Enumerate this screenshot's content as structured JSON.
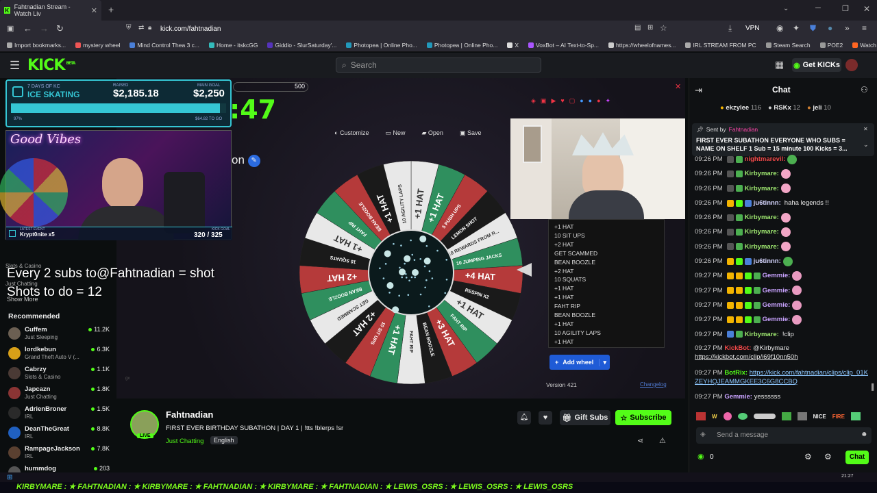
{
  "browser": {
    "tab_title": "Fahtnadian Stream - Watch Liv",
    "url": "kick.com/fahtnadian",
    "vpn_label": "VPN",
    "bookmarks": [
      "Import bookmarks...",
      "mystery wheel",
      "Mind Control Thea 3 c...",
      "Home - itskcGG",
      "Giddio - SlurSaturday'...",
      "Photopea | Online Pho...",
      "Photopea | Online Pho...",
      "X",
      "VoxBot – AI Text-to-Sp...",
      "https://wheelofnames...",
      "IRL STREAM FROM PC",
      "Steam Search",
      "POE2",
      "Watch Supernatural - ..."
    ]
  },
  "header": {
    "logo": "KICK",
    "logo_badge": "BETA",
    "search_placeholder": "Search",
    "get_kicks": "Get KICKs"
  },
  "sidebar": {
    "behind_overlay": [
      "Slots & Casino",
      "Just Chatting",
      "Show More"
    ],
    "recommended_title": "Recommended",
    "items": [
      {
        "name": "Cuffem",
        "category": "Just Sleeping",
        "viewers": "11.2K",
        "color": "#6b5f52"
      },
      {
        "name": "lordkebun",
        "category": "Grand Theft Auto V (...",
        "viewers": "6.3K",
        "color": "#d8a018"
      },
      {
        "name": "Cabrzy",
        "category": "Slots & Casino",
        "viewers": "1.1K",
        "color": "#4a3a35"
      },
      {
        "name": "Japcazn",
        "category": "Just Chatting",
        "viewers": "1.8K",
        "color": "#8a3434"
      },
      {
        "name": "AdrienBroner",
        "category": "IRL",
        "viewers": "1.5K",
        "color": "#2a2a2a"
      },
      {
        "name": "DeanTheGreat",
        "category": "IRL",
        "viewers": "8.8K",
        "color": "#2060c0"
      },
      {
        "name": "RampageJackson",
        "category": "IRL",
        "viewers": "7.8K",
        "color": "#5a4030"
      },
      {
        "name": "hummdog",
        "category": "",
        "viewers": "203",
        "color": "#555"
      }
    ]
  },
  "stream": {
    "goal": {
      "subtitle": "7 DAYS OF KC",
      "title": "ICE SKATING",
      "raised_label": "RAISED",
      "raised": "$2,185.18",
      "main_goal_label": "MAIN GOAL",
      "main_goal": "$2,250",
      "percent_text": "97%",
      "remaining": "$64.82 TO GO",
      "progress": 0.97
    },
    "latest_event_label": "LATEST EVENT",
    "latest_event": "Krypt0nite x5",
    "kick_goal_label": "KICK GOAL",
    "kick_goal": "320 / 325",
    "timer_fragment": ":47",
    "timer_max": "500",
    "toolbar": [
      "Customize",
      "New",
      "Open",
      "Save"
    ],
    "title_fragment": "on",
    "overlay_line1": "Every 2 subs to@Fahtnadian = shot",
    "overlay_line2": "Shots to do = 12",
    "wheel_center_caption": "",
    "wheel_segments": [
      "+1 HAT",
      "+1 HAT",
      "5 PUSH UPS",
      "LEMON SHOT",
      "10 REWARDS FROM R...",
      "10 JUMPING JACKS",
      "+4 HAT",
      "RESPIN X2",
      "+1 HAT",
      "FAHT RIP",
      "+3 HAT",
      "BEAN BOOZLE",
      "FAHT RIP",
      "+1 HAT",
      "10 SIT UPS",
      "+2 HAT",
      "GET SCAMMED",
      "BEAN BOOZLE",
      "+2 HAT",
      "10 SQUATS",
      "+1 HAT",
      "FAHT RIP",
      "BEAN BOOZLE",
      "+1 HAT",
      "10 AGILITY LAPS"
    ],
    "options_list": [
      "+1 HAT",
      "10 SIT UPS",
      "+2 HAT",
      "GET SCAMMED",
      "BEAN BOOZLE",
      "+2 HAT",
      "10 SQUATS",
      "+1 HAT",
      "+1 HAT",
      "FAHT RIP",
      "BEAN BOOZLE",
      "+1 HAT",
      "10 AGILITY LAPS",
      "+1 HAT"
    ],
    "add_wheel": "Add wheel",
    "version": "Version 421",
    "changelog": "Changelog"
  },
  "channel": {
    "name": "Fahtnadian",
    "live": "LIVE",
    "title": "FIRST EVER BIRTHDAY SUBATHON | DAY 1 | !tts !blerps !sr",
    "category": "Just Chatting",
    "language": "English",
    "gift_subs": "Gift Subs",
    "subscribe": "Subscribe"
  },
  "chat": {
    "title": "Chat",
    "top_gifters": [
      {
        "name": "ekzylee",
        "count": "116"
      },
      {
        "name": "RSKx",
        "count": "12"
      },
      {
        "name": "jeli",
        "count": "10"
      }
    ],
    "pinned_sender_prefix": "Sent by",
    "pinned_sender": "Fahtnadian",
    "pinned_text": "FIRST EVER SUBATHON EVERYONE WHO SUBS = NAME ON SHELF 1 Sub = 15 minute 100 Kicks = 3...",
    "messages": [
      {
        "time": "09:26 PM",
        "user": "nightmarevil:",
        "color": "#f04848",
        "text": ""
      },
      {
        "time": "09:26 PM",
        "user": "Kirbymare:",
        "color": "#9fe870",
        "text": ""
      },
      {
        "time": "09:26 PM",
        "user": "Kirbymare:",
        "color": "#9fe870",
        "text": ""
      },
      {
        "time": "09:26 PM",
        "user": "ju6tinnn:",
        "color": "#d6d6ff",
        "text": "haha legends !!"
      },
      {
        "time": "09:26 PM",
        "user": "Kirbymare:",
        "color": "#9fe870",
        "text": ""
      },
      {
        "time": "09:26 PM",
        "user": "Kirbymare:",
        "color": "#9fe870",
        "text": ""
      },
      {
        "time": "09:26 PM",
        "user": "Kirbymare:",
        "color": "#9fe870",
        "text": ""
      },
      {
        "time": "09:26 PM",
        "user": "ju6tinnn:",
        "color": "#d6d6ff",
        "text": ""
      },
      {
        "time": "09:27 PM",
        "user": "Gemmie:",
        "color": "#c9a3ff",
        "text": ""
      },
      {
        "time": "09:27 PM",
        "user": "Gemmie:",
        "color": "#c9a3ff",
        "text": ""
      },
      {
        "time": "09:27 PM",
        "user": "Gemmie:",
        "color": "#c9a3ff",
        "text": ""
      },
      {
        "time": "09:27 PM",
        "user": "Gemmie:",
        "color": "#c9a3ff",
        "text": ""
      },
      {
        "time": "09:27 PM",
        "user": "Kirbymare:",
        "color": "#9fe870",
        "text": "!clip"
      }
    ],
    "kickbot": {
      "time": "09:27 PM",
      "user": "KickBot:",
      "text": "@Kirbymare",
      "link": "https://kickbot.com/clip/i69f10nn50h"
    },
    "botrix": {
      "time": "09:27 PM",
      "user": "BotRix:",
      "link": "https://kick.com/fahtnadian/clips/clip_01KZEYHQJEAMMGKEE3C6G8CCBQ"
    },
    "last": {
      "time": "09:27 PM",
      "user": "Gemmie:",
      "text": "yessssss"
    },
    "emote_labels": [
      "NICE",
      "FIRE"
    ],
    "input_placeholder": "Send a message",
    "kick_count": "0",
    "chat_button": "Chat"
  },
  "ticker": {
    "text": "KIRBYMARE : ★ FAHTNADIAN : ★ KIRBYMARE : ★ FAHTNADIAN : ★ KIRBYMARE : ★ FAHTNADIAN : ★ LEWIS_OSRS : ★ LEWIS_OSRS : ★ LEWIS_OSRS"
  },
  "taskbar": {
    "time": "21:27"
  },
  "colors": {
    "kick_green": "#53fc18",
    "goal_cyan": "#35c6d4"
  }
}
